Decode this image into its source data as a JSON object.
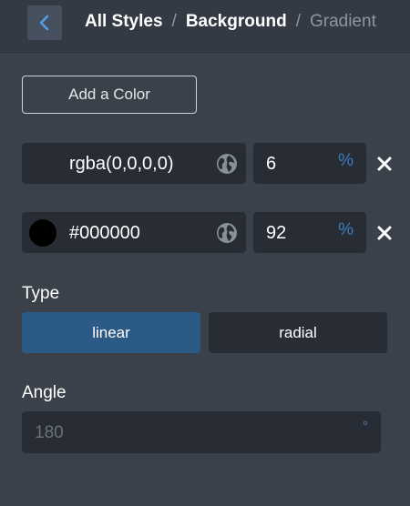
{
  "header": {
    "breadcrumb": [
      "All Styles",
      "Background",
      "Gradient"
    ],
    "separator": "/"
  },
  "add_color_label": "Add a Color",
  "stops": [
    {
      "color_text": "rgba(0,0,0,0)",
      "swatch": "transparent",
      "position": "6",
      "unit": "%"
    },
    {
      "color_text": "#000000",
      "swatch": "#000000",
      "position": "92",
      "unit": "%"
    }
  ],
  "type": {
    "label": "Type",
    "options": [
      "linear",
      "radial"
    ],
    "selected": "linear"
  },
  "angle": {
    "label": "Angle",
    "value": "180",
    "unit": "°"
  },
  "colors": {
    "accent": "#2c5a87",
    "panel_bg": "#3b414a",
    "field_bg": "#282d35",
    "unit_blue": "#3d7cc0"
  },
  "icons": {
    "back": "chevron-left-icon",
    "globe": "globe-icon",
    "remove": "close-icon"
  }
}
